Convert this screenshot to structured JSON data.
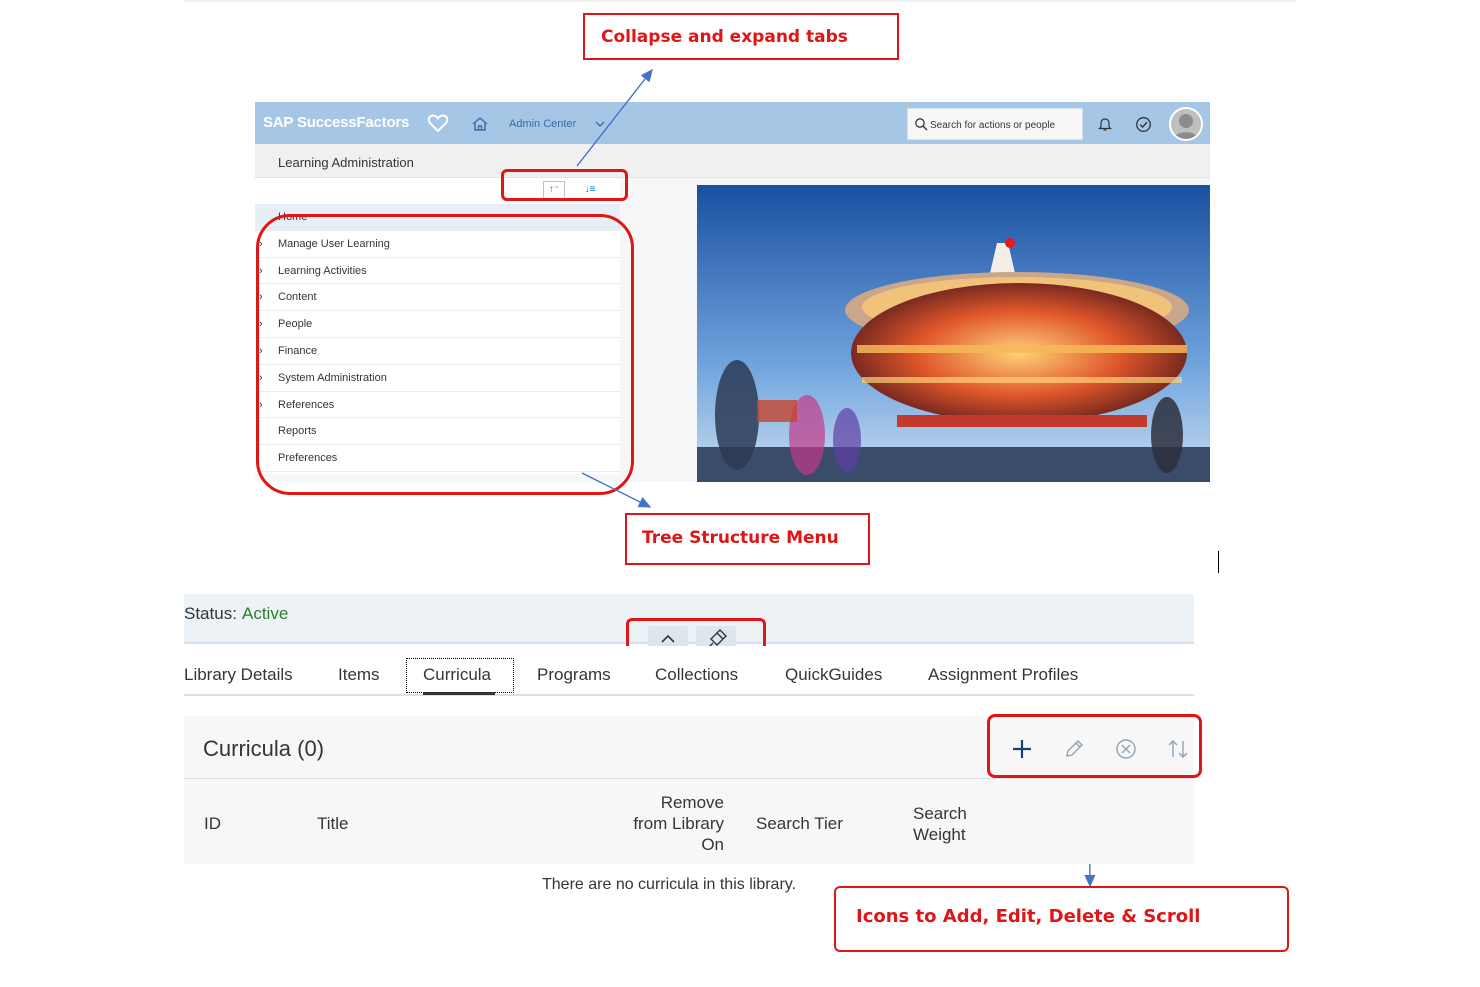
{
  "sap": {
    "logo": "SAP SuccessFactors",
    "nav_label": "Admin Center",
    "search_placeholder": "Search for actions or people",
    "page_title": "Learning Administration",
    "tree_items": [
      {
        "label": "Home",
        "expandable": false
      },
      {
        "label": "Manage User Learning",
        "expandable": true
      },
      {
        "label": "Learning Activities",
        "expandable": true
      },
      {
        "label": "Content",
        "expandable": true
      },
      {
        "label": "People",
        "expandable": true
      },
      {
        "label": "Finance",
        "expandable": true
      },
      {
        "label": "System Administration",
        "expandable": true
      },
      {
        "label": "References",
        "expandable": true
      },
      {
        "label": "Reports",
        "expandable": false
      },
      {
        "label": "Preferences",
        "expandable": false
      }
    ],
    "colors": {
      "shell_bar": "#a6c6e5",
      "link": "#3a6ea5"
    }
  },
  "annotations": {
    "collapse_expand": "Collapse and expand tabs",
    "tree_menu": "Tree Structure Menu",
    "icons": "Icons to Add, Edit, Delete & Scroll",
    "color": "#e01515"
  },
  "library": {
    "status_label": "Status:",
    "status_value": "Active",
    "tabs": [
      "Library Details",
      "Items",
      "Curricula",
      "Programs",
      "Collections",
      "QuickGuides",
      "Assignment Profiles"
    ],
    "selected_tab": "Curricula",
    "panel_title": "Curricula (0)",
    "toolbar_icons": [
      "add-icon",
      "edit-icon",
      "delete-icon",
      "sort-icon"
    ],
    "columns": [
      "ID",
      "Title",
      "Remove from Library On",
      "Search Tier",
      "Search Weight"
    ],
    "empty_message": "There are no curricula in this library.",
    "status_color": "#2b7d2b"
  }
}
